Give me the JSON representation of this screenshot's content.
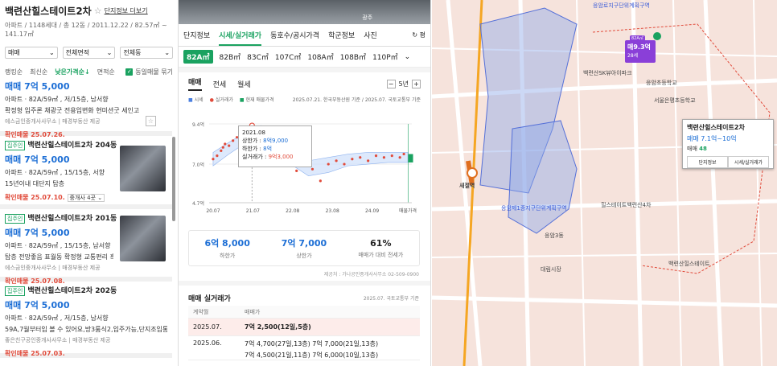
{
  "complex": {
    "name": "백련산힐스테이트2차",
    "more_link": "단지정보 더보기",
    "summary": "아파트 / 1148세대 / 총 12동 / 2011.12.22 / 82.57㎡ ~ 141.17㎡"
  },
  "filters": {
    "trade": "매매",
    "area": "전체면적",
    "dong": "전체동"
  },
  "sort": {
    "options": [
      "랭킹순",
      "최신순",
      "낮은가격순↓",
      "면적순"
    ],
    "active_index": 2,
    "group_label": "동일매물 묶기"
  },
  "listings": [
    {
      "badge": "",
      "title": "",
      "price": "매매 7억 5,000",
      "spec": "아파트 · 82A/59㎡ , 저/15층, 남서향",
      "desc": "확정형 입주론 채광굿 전용입변화 현미션굿 세인고",
      "agent": "에스금인중개사사무소 | 매경부동산 제공",
      "confirmed": "확인매물 25.07.26.",
      "has_photo": false
    },
    {
      "badge": "집주인",
      "title": "백련산힐스테이트2차 204동",
      "price": "매매 7억 5,000",
      "spec": "아파트 · 82A/59㎡ , 15/15층, 서향",
      "desc": "15년이내  대단지  탑층",
      "agent": "",
      "confirmed": "확인매물 25.07.10.",
      "brokers": "중개사 4곳",
      "has_photo": true
    },
    {
      "badge": "집주인",
      "title": "백련산힐스테이트2차 201동",
      "price": "매매 7억 5,000",
      "spec": "아파트 · 82A/59㎡ , 15/15층, 남서향",
      "desc": "탑층 전망좋음 표월동 확정형 교통편리 흑...",
      "agent": "에스금인중개사사무소 | 매경부동산 제공",
      "confirmed": "확인매물 25.07.08.",
      "has_photo": true
    },
    {
      "badge": "집주인",
      "title": "백련산힐스테이트2차 202동",
      "price": "매매 7억 5,000",
      "spec": "아파트 · 82A/59㎡ , 저/15층, 남서향",
      "desc": "59A,7월부터입 볼 수 있어요,방3룸식2,입주가능,단지조입통평지",
      "agent": "좋은친구공인중개사사무소 | 매경부동산 제공",
      "confirmed": "확인매물 25.07.03.",
      "has_photo": false
    }
  ],
  "photo_strip": [
    "",
    "광주"
  ],
  "detail_tabs": [
    "단지정보",
    "시세/실거래가",
    "동호수/공시가격",
    "학군정보",
    "사진"
  ],
  "detail_active": 1,
  "detail_right": "평",
  "areas": [
    "82A㎡",
    "82B㎡",
    "83C㎡",
    "107C㎡",
    "108A㎡",
    "108B㎡",
    "110P㎡"
  ],
  "area_active": 0,
  "trade_tabs": [
    "매매",
    "전세",
    "월세"
  ],
  "period": "5년",
  "legend": {
    "items": [
      "시세",
      "실거래가",
      "현재 매물가격"
    ],
    "source": "2025.07.21. 한국부동산원 기준 / 2025.07. 국토교통부 기준"
  },
  "chart_data": {
    "type": "scatter",
    "x_ticks": [
      "20.07",
      "21.07",
      "22.08",
      "23.08",
      "24.09",
      "매물가격"
    ],
    "y_ticks": [
      "9.4억",
      "7.0억",
      "4.7억"
    ],
    "ylim": [
      4.7,
      9.4
    ],
    "xlim": [
      2020.5,
      2025.6
    ],
    "band_low": [
      [
        2020.6,
        6.9
      ],
      [
        2021.0,
        7.6
      ],
      [
        2021.5,
        8.4
      ],
      [
        2021.8,
        8.8
      ],
      [
        2022.2,
        8.5
      ],
      [
        2022.45,
        8.0
      ],
      [
        2022.55,
        7.0
      ],
      [
        2023.0,
        6.3
      ],
      [
        2023.5,
        6.5
      ],
      [
        2024.0,
        6.9
      ],
      [
        2024.5,
        7.0
      ],
      [
        2025.0,
        7.1
      ],
      [
        2025.5,
        7.1
      ]
    ],
    "band_high": [
      [
        2020.6,
        7.7
      ],
      [
        2021.0,
        8.3
      ],
      [
        2021.5,
        9.0
      ],
      [
        2021.8,
        9.3
      ],
      [
        2022.2,
        9.0
      ],
      [
        2022.45,
        8.5
      ],
      [
        2022.55,
        7.6
      ],
      [
        2023.0,
        7.2
      ],
      [
        2023.5,
        7.4
      ],
      [
        2024.0,
        7.6
      ],
      [
        2024.5,
        7.7
      ],
      [
        2025.0,
        7.7
      ],
      [
        2025.5,
        7.7
      ]
    ],
    "trades": [
      {
        "x": 2020.6,
        "y": 7.3
      },
      {
        "x": 2020.7,
        "y": 7.5
      },
      {
        "x": 2020.8,
        "y": 7.8
      },
      {
        "x": 2020.85,
        "y": 8.0
      },
      {
        "x": 2020.9,
        "y": 8.2
      },
      {
        "x": 2021.0,
        "y": 8.1
      },
      {
        "x": 2021.1,
        "y": 8.4
      },
      {
        "x": 2021.2,
        "y": 8.6
      },
      {
        "x": 2021.3,
        "y": 8.5
      },
      {
        "x": 2021.4,
        "y": 8.8
      },
      {
        "x": 2021.5,
        "y": 9.0
      },
      {
        "x": 2021.55,
        "y": 9.1
      },
      {
        "x": 2021.58,
        "y": 9.3
      },
      {
        "x": 2021.7,
        "y": 8.8
      },
      {
        "x": 2021.9,
        "y": 8.6
      },
      {
        "x": 2022.1,
        "y": 8.4
      },
      {
        "x": 2022.3,
        "y": 8.2
      },
      {
        "x": 2022.5,
        "y": 7.2
      },
      {
        "x": 2022.7,
        "y": 6.6
      },
      {
        "x": 2022.9,
        "y": 6.9
      },
      {
        "x": 2023.1,
        "y": 6.7
      },
      {
        "x": 2023.3,
        "y": 6.0
      },
      {
        "x": 2023.5,
        "y": 7.0
      },
      {
        "x": 2023.7,
        "y": 7.2
      },
      {
        "x": 2023.9,
        "y": 7.0
      },
      {
        "x": 2024.1,
        "y": 7.3
      },
      {
        "x": 2024.3,
        "y": 7.4
      },
      {
        "x": 2024.5,
        "y": 7.2
      },
      {
        "x": 2024.7,
        "y": 7.5
      },
      {
        "x": 2024.9,
        "y": 7.4
      },
      {
        "x": 2025.1,
        "y": 7.5
      },
      {
        "x": 2025.3,
        "y": 7.4
      },
      {
        "x": 2025.4,
        "y": 7.6
      }
    ],
    "current_listing": [
      7.1,
      7.6
    ],
    "highlight": {
      "x": 2021.58,
      "y": 9.3
    }
  },
  "tooltip": {
    "date": "2021.08",
    "rows": [
      {
        "label": "상한가 : ",
        "value": "8억9,000"
      },
      {
        "label": "하한가 : ",
        "value": "8억"
      },
      {
        "label": "실거래가 : ",
        "value": "9억3,000"
      }
    ]
  },
  "stats": [
    {
      "value": "6억 8,000",
      "label": "하한가"
    },
    {
      "value": "7억 7,000",
      "label": "상한가"
    },
    {
      "value": "61%",
      "label": "매매가 대비 전세가"
    }
  ],
  "provider": "제공처 : 가나공인중개사사무소 02-509-0900",
  "history": {
    "title": "매매 실거래가",
    "source": "2025.07. 국토교통부 기준",
    "head": [
      "계약월",
      "매매가"
    ],
    "rows": [
      {
        "month": "2025.07.",
        "prices": [
          "7억 2,500(12일,5층)"
        ],
        "hl": true
      },
      {
        "month": "2025.06.",
        "prices": [
          "7억 4,700(27일,13층)   7억 7,000(21일,13층)",
          "7억 4,500(21일,11층)   7억 6,000(10일,13층)"
        ],
        "hl": false
      }
    ]
  },
  "map": {
    "labels": [
      "응암로지구단위계획구역",
      "응암초등학교",
      "백련산SK뷰아이파크",
      "새절역",
      "응암제1종지구단위계획구역",
      "응암3동",
      "힐스테이트백련산4차",
      "백련산힐스테이트",
      "대림시장",
      "서울은평초등학교"
    ],
    "marker": {
      "tag": "82A㎡",
      "price": "매9.3억",
      "sub": "28세"
    },
    "popup": {
      "title": "백련산힐스테이트2차",
      "price": "매매 7.1억~10억",
      "count_label": "매매",
      "count": "48",
      "buttons": [
        "단지정보",
        "시세/실거래가"
      ]
    }
  },
  "colors": {
    "accent": "#1aa260",
    "price_blue": "#1c6ed5",
    "alert": "#e14b3b",
    "marker": "#8a3fd8"
  }
}
